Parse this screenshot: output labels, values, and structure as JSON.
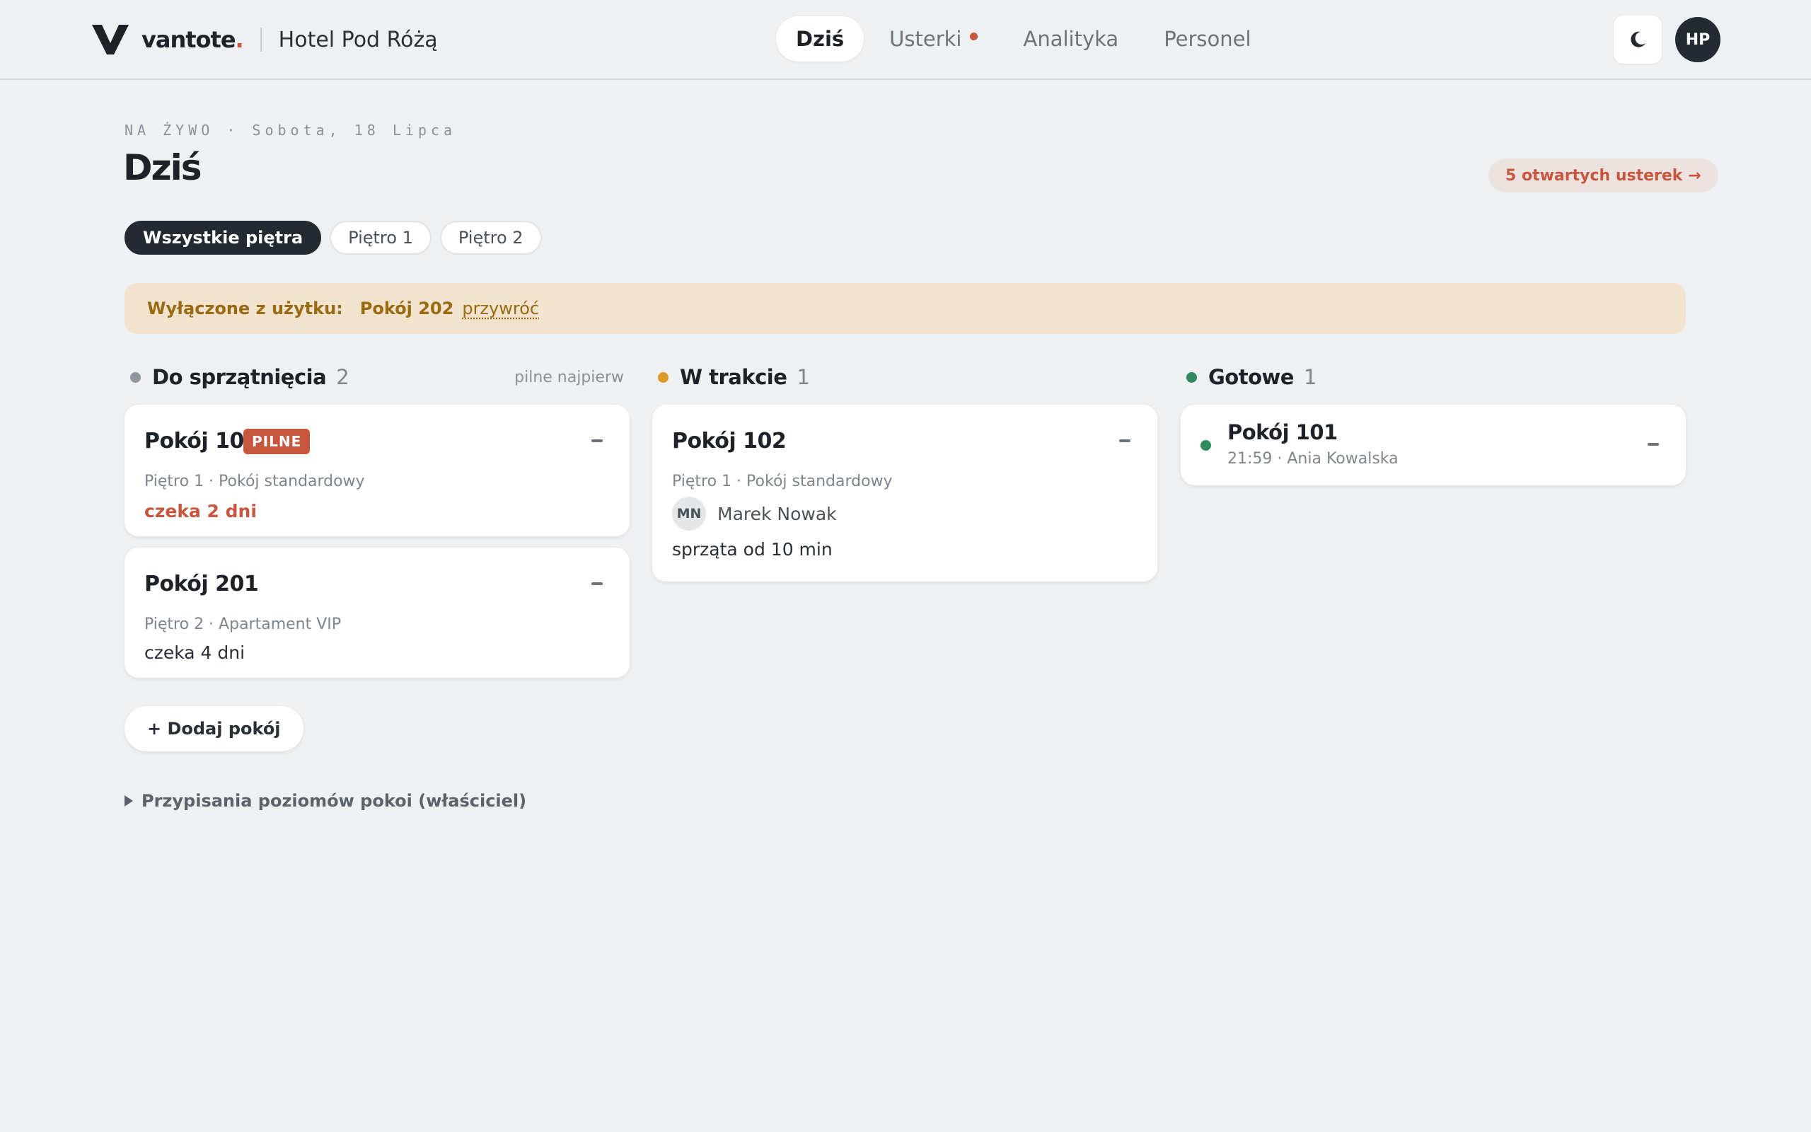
{
  "header": {
    "brand_name": "vantote",
    "brand_dot": ".",
    "hotel_name": "Hotel Pod Różą",
    "nav": [
      {
        "label": "Dziś",
        "active": true
      },
      {
        "label": "Usterki",
        "has_indicator": true
      },
      {
        "label": "Analityka"
      },
      {
        "label": "Personel"
      }
    ],
    "theme_icon": "moon-icon",
    "user_initials": "HP"
  },
  "page": {
    "eyebrow": "NA ŻYWO · Sobota, 18 Lipca",
    "title": "Dziś",
    "issues_link": "5 otwartych usterek →"
  },
  "filters": [
    "Wszystkie piętra",
    "Piętro 1",
    "Piętro 2"
  ],
  "banner": {
    "label": "Wyłączone z użytku:",
    "room": "Pokój 202",
    "restore": "przywróć"
  },
  "columns": {
    "todo": {
      "title": "Do sprzątnięcia",
      "count": "2",
      "sort": "pilne najpierw",
      "color": "#8f979e",
      "cards": [
        {
          "room": "Pokój 103",
          "badge": "PILNE",
          "meta": "Piętro 1 · Pokój standardowy",
          "wait": "czeka 2 dni"
        },
        {
          "room": "Pokój 201",
          "meta": "Piętro 2 · Apartament VIP",
          "wait": "czeka 4 dni"
        }
      ]
    },
    "in_progress": {
      "title": "W trakcie",
      "count": "1",
      "color": "#d99a2b",
      "cards": [
        {
          "room": "Pokój 102",
          "meta": "Piętro 1 · Pokój standardowy",
          "initials": "MN",
          "assignee": "Marek Nowak",
          "status": "sprząta od 10 min"
        }
      ]
    },
    "done": {
      "title": "Gotowe",
      "count": "1",
      "color": "#2f8a5e",
      "cards": [
        {
          "room": "Pokój 101",
          "meta": "21:59 · Ania Kowalska"
        }
      ]
    }
  },
  "add_room": "+ Dodaj pokój",
  "assignments_toggle": "Przypisania poziomów pokoi (właściciel)"
}
